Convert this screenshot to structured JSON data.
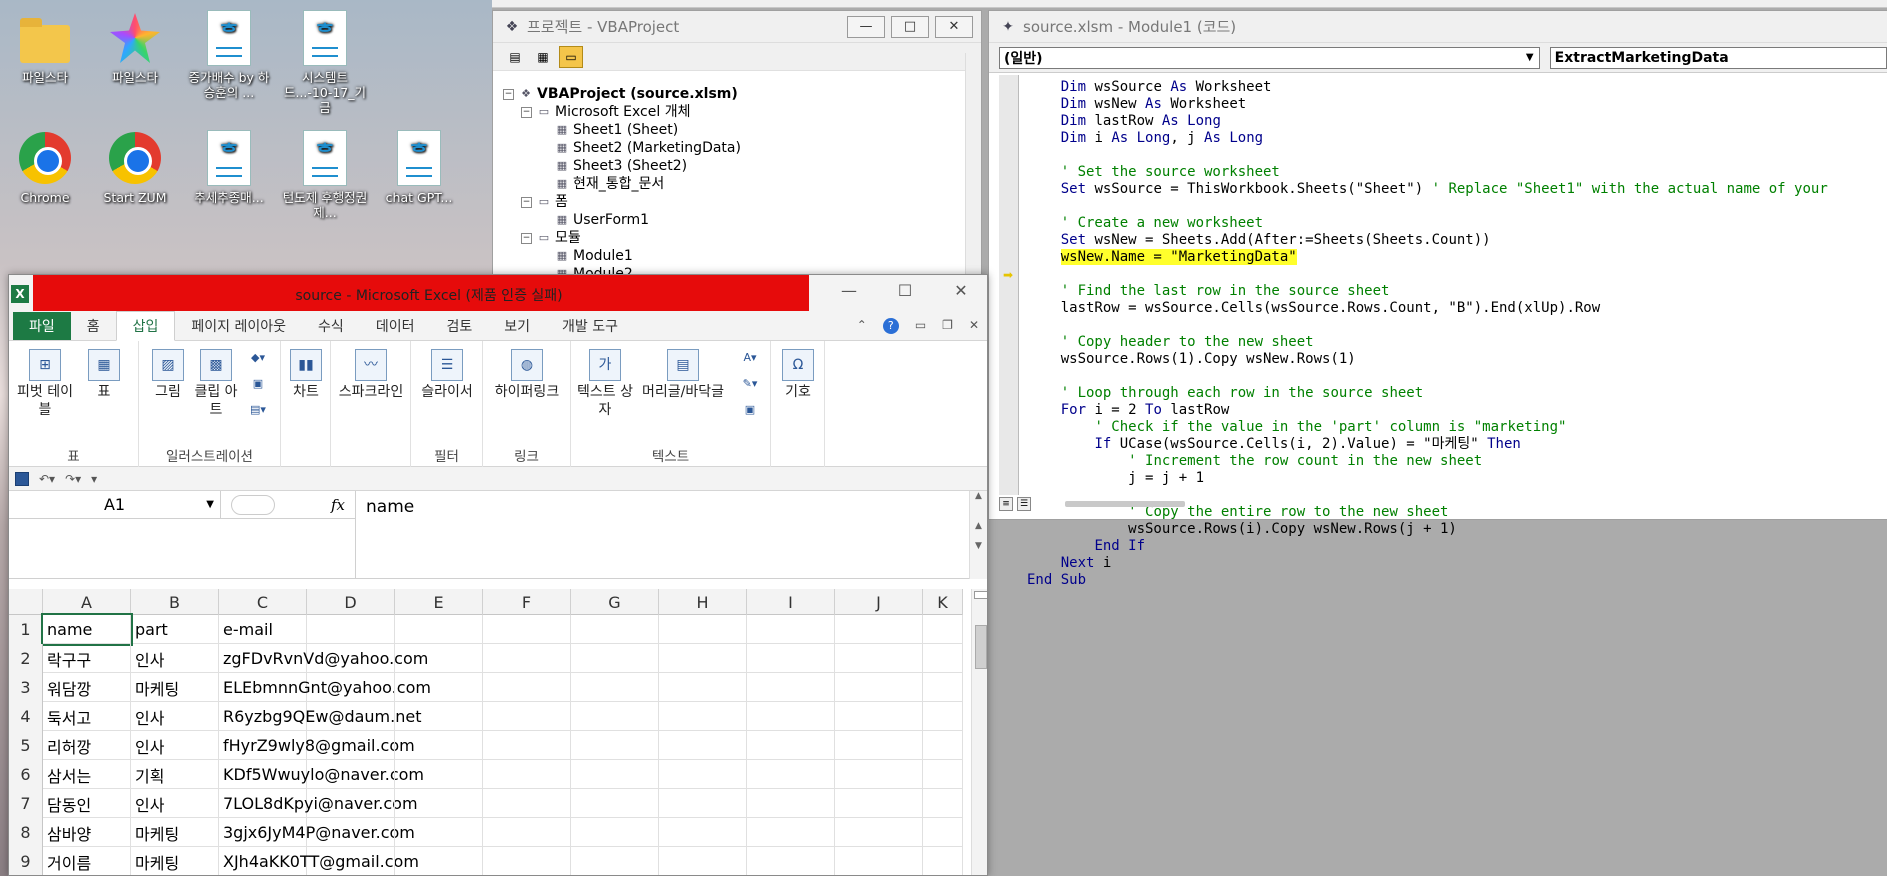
{
  "desktop": {
    "icons": [
      {
        "label": "파일스타"
      },
      {
        "label": "파일스타"
      },
      {
        "label": "증가배수 by 하승훈의 ..."
      },
      {
        "label": "시스템트드...-10-17_기금"
      },
      {
        "label": "Chrome"
      },
      {
        "label": "Start ZUM"
      },
      {
        "label": "추세추종매..."
      },
      {
        "label": "턴도제 후행정권제..."
      },
      {
        "label": "chat GPT..."
      }
    ]
  },
  "project": {
    "title": "프로젝트 - VBAProject",
    "tree": [
      {
        "label": "VBAProject (source.xlsm)",
        "depth": 0,
        "exp": "⊟",
        "bold": true
      },
      {
        "label": "Microsoft Excel 개체",
        "depth": 1,
        "exp": "⊟"
      },
      {
        "label": "Sheet1 (Sheet)",
        "depth": 2,
        "exp": ""
      },
      {
        "label": "Sheet2 (MarketingData)",
        "depth": 2,
        "exp": ""
      },
      {
        "label": "Sheet3 (Sheet2)",
        "depth": 2,
        "exp": ""
      },
      {
        "label": "현재_통합_문서",
        "depth": 2,
        "exp": ""
      },
      {
        "label": "폼",
        "depth": 1,
        "exp": "⊟"
      },
      {
        "label": "UserForm1",
        "depth": 2,
        "exp": ""
      },
      {
        "label": "모듈",
        "depth": 1,
        "exp": "⊟"
      },
      {
        "label": "Module1",
        "depth": 2,
        "exp": ""
      },
      {
        "label": "Module2",
        "depth": 2,
        "exp": ""
      }
    ]
  },
  "code": {
    "title": "source.xlsm - Module1 (코드)",
    "object_combo": "(일반)",
    "proc_combo": "ExtractMarketingData",
    "lines": [
      [
        {
          "t": "    "
        },
        {
          "t": "Dim",
          "c": "kw"
        },
        {
          "t": " wsSource "
        },
        {
          "t": "As",
          "c": "kw"
        },
        {
          "t": " Worksheet"
        }
      ],
      [
        {
          "t": "    "
        },
        {
          "t": "Dim",
          "c": "kw"
        },
        {
          "t": " wsNew "
        },
        {
          "t": "As",
          "c": "kw"
        },
        {
          "t": " Worksheet"
        }
      ],
      [
        {
          "t": "    "
        },
        {
          "t": "Dim",
          "c": "kw"
        },
        {
          "t": " lastRow "
        },
        {
          "t": "As",
          "c": "kw"
        },
        {
          "t": " "
        },
        {
          "t": "Long",
          "c": "kw"
        }
      ],
      [
        {
          "t": "    "
        },
        {
          "t": "Dim",
          "c": "kw"
        },
        {
          "t": " i "
        },
        {
          "t": "As",
          "c": "kw"
        },
        {
          "t": " "
        },
        {
          "t": "Long",
          "c": "kw"
        },
        {
          "t": ", j "
        },
        {
          "t": "As",
          "c": "kw"
        },
        {
          "t": " "
        },
        {
          "t": "Long",
          "c": "kw"
        }
      ],
      [
        {
          "t": ""
        }
      ],
      [
        {
          "t": "    "
        },
        {
          "t": "' Set the source worksheet",
          "c": "cm"
        }
      ],
      [
        {
          "t": "    "
        },
        {
          "t": "Set",
          "c": "kw"
        },
        {
          "t": " wsSource = ThisWorkbook.Sheets(\"Sheet\") "
        },
        {
          "t": "' Replace \"Sheet1\" with the actual name of your",
          "c": "cm"
        }
      ],
      [
        {
          "t": ""
        }
      ],
      [
        {
          "t": "    "
        },
        {
          "t": "' Create a new worksheet",
          "c": "cm"
        }
      ],
      [
        {
          "t": "    "
        },
        {
          "t": "Set",
          "c": "kw"
        },
        {
          "t": " wsNew = Sheets.Add(After:=Sheets(Sheets.Count))"
        }
      ],
      [
        {
          "t": "    "
        },
        {
          "t": "wsNew.Name = \"MarketingData\"",
          "c": "hl"
        }
      ],
      [
        {
          "t": ""
        }
      ],
      [
        {
          "t": "    "
        },
        {
          "t": "' Find the last row in the source sheet",
          "c": "cm"
        }
      ],
      [
        {
          "t": "    lastRow = wsSource.Cells(wsSource.Rows.Count, \"B\").End(xlUp).Row"
        }
      ],
      [
        {
          "t": ""
        }
      ],
      [
        {
          "t": "    "
        },
        {
          "t": "' Copy header to the new sheet",
          "c": "cm"
        }
      ],
      [
        {
          "t": "    wsSource.Rows(1).Copy wsNew.Rows(1)"
        }
      ],
      [
        {
          "t": ""
        }
      ],
      [
        {
          "t": "    "
        },
        {
          "t": "' Loop through each row in the source sheet",
          "c": "cm"
        }
      ],
      [
        {
          "t": "    "
        },
        {
          "t": "For",
          "c": "kw"
        },
        {
          "t": " i = 2 "
        },
        {
          "t": "To",
          "c": "kw"
        },
        {
          "t": " lastRow"
        }
      ],
      [
        {
          "t": "        "
        },
        {
          "t": "' Check if the value in the 'part' column is \"marketing\"",
          "c": "cm"
        }
      ],
      [
        {
          "t": "        "
        },
        {
          "t": "If",
          "c": "kw"
        },
        {
          "t": " UCase(wsSource.Cells(i, 2).Value) = \"마케팅\" "
        },
        {
          "t": "Then",
          "c": "kw"
        }
      ],
      [
        {
          "t": "            "
        },
        {
          "t": "' Increment the row count in the new sheet",
          "c": "cm"
        }
      ],
      [
        {
          "t": "            j = j + 1"
        }
      ],
      [
        {
          "t": ""
        }
      ],
      [
        {
          "t": "            "
        },
        {
          "t": "' Copy the entire row to the new sheet",
          "c": "cm"
        }
      ],
      [
        {
          "t": "            wsSource.Rows(i).Copy wsNew.Rows(j + 1)"
        }
      ],
      [
        {
          "t": "        "
        },
        {
          "t": "End If",
          "c": "kw"
        }
      ],
      [
        {
          "t": "    "
        },
        {
          "t": "Next",
          "c": "kw"
        },
        {
          "t": " i"
        }
      ],
      [
        {
          "t": "End Sub",
          "c": "kw"
        }
      ]
    ]
  },
  "excel": {
    "title": "source  -  Microsoft Excel (제품 인증 실패)",
    "tabs": [
      "파일",
      "홈",
      "삽입",
      "페이지 레이아웃",
      "수식",
      "데이터",
      "검토",
      "보기",
      "개발 도구"
    ],
    "active_tab": "삽입",
    "ribbon": {
      "pivot": "피벗 테이블",
      "table": "표",
      "picture": "그림",
      "clipart": "클립 아트",
      "chart": "차트",
      "sparkline": "스파크라인",
      "slicer": "슬라이서",
      "hyperlink": "하이퍼링크",
      "textbox": "텍스트 상자",
      "headerfooter": "머리글/바닥글",
      "symbol": "기호",
      "groups": {
        "tables": "표",
        "illustrations": "일러스트레이션",
        "filter": "필터",
        "links": "링크",
        "text": "텍스트"
      }
    },
    "namebox": "A1",
    "formula": "name",
    "columns": [
      "A",
      "B",
      "C",
      "D",
      "E",
      "F",
      "G",
      "H",
      "I",
      "J",
      "K"
    ],
    "rows": [
      {
        "n": "1",
        "cells": [
          "name",
          "part",
          "e-mail"
        ]
      },
      {
        "n": "2",
        "cells": [
          "락구구",
          "인사",
          "zgFDvRvnVd@yahoo.com"
        ]
      },
      {
        "n": "3",
        "cells": [
          "워담깡",
          "마케팅",
          "ELEbmnnGnt@yahoo.com"
        ]
      },
      {
        "n": "4",
        "cells": [
          "둑서고",
          "인사",
          "R6yzbg9QEw@daum.net"
        ]
      },
      {
        "n": "5",
        "cells": [
          "리허깡",
          "인사",
          "fHyrZ9wly8@gmail.com"
        ]
      },
      {
        "n": "6",
        "cells": [
          "삼서는",
          "기획",
          "KDf5Wwuylo@naver.com"
        ]
      },
      {
        "n": "7",
        "cells": [
          "담동인",
          "인사",
          "7LOL8dKpyi@naver.com"
        ]
      },
      {
        "n": "8",
        "cells": [
          "삼바양",
          "마케팅",
          "3gjx6JyM4P@naver.com"
        ]
      },
      {
        "n": "9",
        "cells": [
          "거이름",
          "마케팅",
          "XJh4aKK0TT@gmail.com"
        ]
      }
    ]
  }
}
